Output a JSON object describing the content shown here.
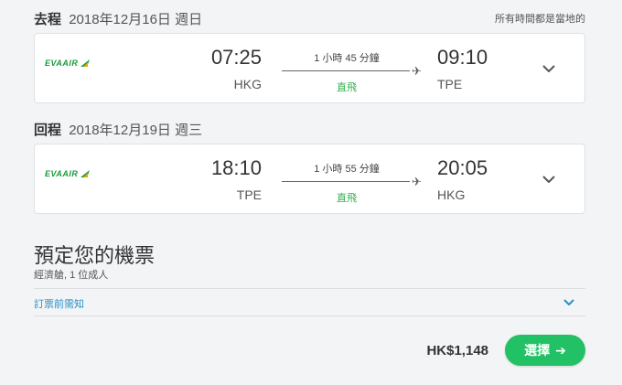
{
  "outbound": {
    "leg_label": "去程",
    "date": "2018年12月16日 週日",
    "airline_logo": "EVAAIR",
    "dep_time": "07:25",
    "dep_code": "HKG",
    "duration": "1 小時 45 分鐘",
    "stops": "直飛",
    "arr_time": "09:10",
    "arr_code": "TPE"
  },
  "local_time_note": "所有時間都是當地的",
  "inbound": {
    "leg_label": "回程",
    "date": "2018年12月19日 週三",
    "airline_logo": "EVAAIR",
    "dep_time": "18:10",
    "dep_code": "TPE",
    "duration": "1 小時 55 分鐘",
    "stops": "直飛",
    "arr_time": "20:05",
    "arr_code": "HKG"
  },
  "booking": {
    "title": "預定您的機票",
    "subtitle": "經濟艙, 1 位成人",
    "notice_label": "訂票前需知"
  },
  "price": "HK$1,148",
  "select_button": {
    "label": "選擇",
    "arrow": "➔"
  },
  "colors": {
    "accent_green": "#23c166",
    "link_blue": "#2a8fc8",
    "nonstop_green": "#2fb04a"
  },
  "icons": {
    "plane": "✈",
    "chevron": "chevron-down-icon"
  }
}
